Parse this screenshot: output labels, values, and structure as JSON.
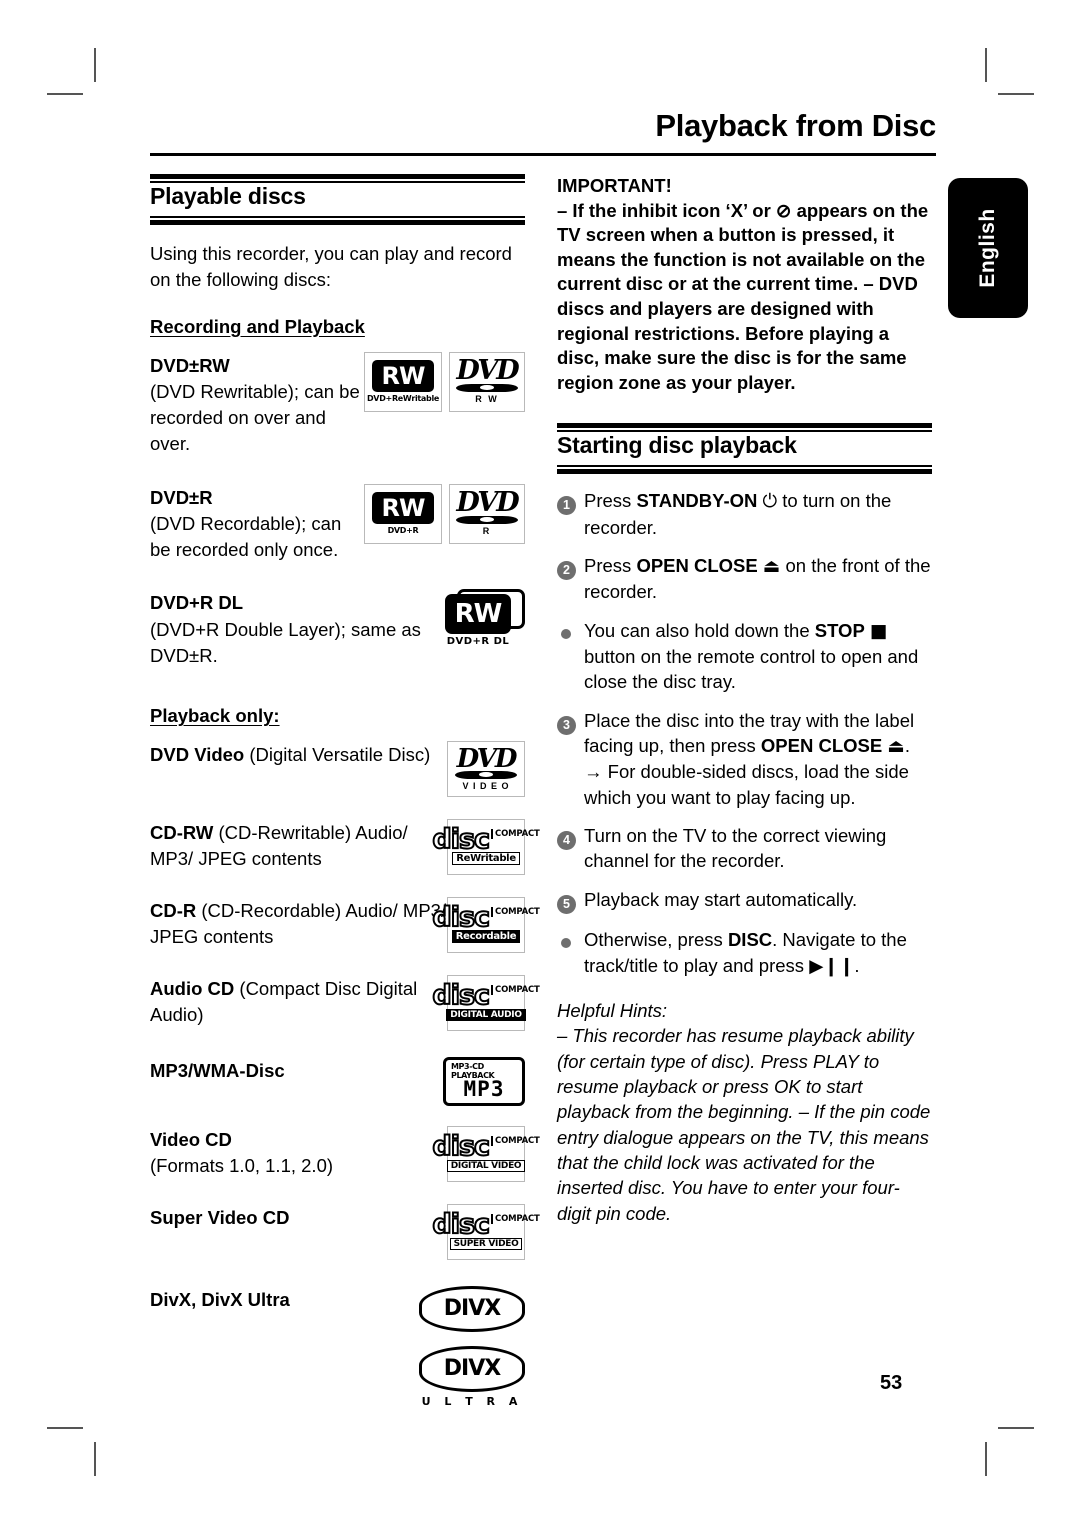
{
  "running_head": "Playback from Disc",
  "language_tab": "English",
  "page_number": "53",
  "left_column": {
    "section_title": "Playable discs",
    "intro": "Using this recorder, you can play and record on the following discs:",
    "subhead_recording": "Recording and Playback",
    "subhead_playback": "Playback only:",
    "recording_items": [
      {
        "title": "DVD±RW",
        "desc": "(DVD Rewritable); can be recorded on over and over.",
        "logos": [
          {
            "type": "rw-box",
            "mark": "RW",
            "caption": "DVD+ReWritable"
          },
          {
            "type": "dvd-box",
            "mark": "DVD",
            "caption": "R W"
          }
        ]
      },
      {
        "title": "DVD±R",
        "desc": "(DVD Recordable); can be recorded only once.",
        "logos": [
          {
            "type": "rw-box",
            "mark": "RW",
            "caption": "DVD+R"
          },
          {
            "type": "dvd-box",
            "mark": "DVD",
            "caption": "R"
          }
        ]
      },
      {
        "title": "DVD+R DL",
        "desc": "(DVD+R Double Layer); same as DVD±R.",
        "logos": [
          {
            "type": "rw-dl",
            "mark": "RW",
            "caption": "DVD+R DL"
          }
        ]
      }
    ],
    "playback_items": [
      {
        "title": "DVD Video",
        "desc": " (Digital Versatile Disc)",
        "logos": [
          {
            "type": "dvd-video",
            "mark": "DVD",
            "caption": "V I D E O"
          }
        ]
      },
      {
        "title": "CD-RW",
        "desc": " (CD-Rewritable) Audio/ MP3/ JPEG contents",
        "logos": [
          {
            "type": "compact-disc",
            "top": "COMPACT",
            "mark": "disc",
            "caption": "ReWritable",
            "invert": false
          }
        ]
      },
      {
        "title": "CD-R",
        "desc": " (CD-Recordable) Audio/ MP3/ JPEG contents",
        "logos": [
          {
            "type": "compact-disc",
            "top": "COMPACT",
            "mark": "disc",
            "caption": "Recordable",
            "invert": true
          }
        ]
      },
      {
        "title": "Audio CD",
        "desc": " (Compact Disc Digital Audio)",
        "logos": [
          {
            "type": "compact-disc",
            "top": "COMPACT",
            "mark": "disc",
            "caption": "DIGITAL AUDIO",
            "invert": true
          }
        ]
      },
      {
        "title": "MP3/WMA-Disc",
        "desc": "",
        "logos": [
          {
            "type": "mp3",
            "top": "MP3-CD PLAYBACK",
            "mark": "MP3"
          }
        ]
      },
      {
        "title": "Video CD",
        "desc": "(Formats 1.0, 1.1, 2.0)",
        "logos": [
          {
            "type": "compact-disc",
            "top": "COMPACT",
            "mark": "disc",
            "caption": "DIGITAL VIDEO",
            "invert": false
          }
        ]
      },
      {
        "title": "Super Video CD",
        "desc": "",
        "logos": [
          {
            "type": "compact-disc",
            "top": "COMPACT",
            "mark": "disc",
            "caption": "SUPER VIDEO",
            "invert": false
          }
        ]
      },
      {
        "title": "DivX, DivX Ultra",
        "desc": "",
        "logos": [
          {
            "type": "divx",
            "mark": "DIVX"
          },
          {
            "type": "divx-ultra",
            "mark": "DIVX",
            "caption": "U L T R A"
          }
        ]
      }
    ]
  },
  "right_column": {
    "important_title": "IMPORTANT!",
    "important_para_1": "– If the inhibit icon ‘X’ or ⊘ appears on the TV screen when a button is pressed, it means the function is not available on the current disc or at the current time.",
    "important_para_2": "– DVD discs and players are designed with regional restrictions. Before playing a disc, make sure the disc is for the same region zone as your player.",
    "section_title": "Starting disc playback",
    "steps": [
      {
        "marker": "1",
        "marker_type": "number",
        "text_before": "Press ",
        "bold": "STANDBY-ON",
        "glyph": "⏻",
        "text_after": " to turn on the recorder."
      },
      {
        "marker": "2",
        "marker_type": "number",
        "text_before": "Press ",
        "bold": "OPEN CLOSE",
        "glyph": "⏏",
        "text_after": " on the front of the recorder."
      },
      {
        "marker": "•",
        "marker_type": "bullet",
        "text_before": "You can also hold down the ",
        "bold": "STOP",
        "glyph": "■",
        "text_after": " button on the remote control to open and close the disc tray."
      },
      {
        "marker": "3",
        "marker_type": "number",
        "text_before": "Place the disc into the tray with the label facing up, then press ",
        "bold": "OPEN CLOSE",
        "glyph": "⏏",
        "text_after": ".",
        "sub": "→ For double-sided discs, load the side which you want to play facing up."
      },
      {
        "marker": "4",
        "marker_type": "number",
        "text_before": "Turn on the TV to the correct viewing channel for the recorder.",
        "bold": "",
        "glyph": "",
        "text_after": ""
      },
      {
        "marker": "5",
        "marker_type": "number",
        "text_before": "Playback may start automatically.",
        "bold": "",
        "glyph": "",
        "text_after": ""
      },
      {
        "marker": "•",
        "marker_type": "bullet",
        "text_before": "Otherwise, press ",
        "bold": "DISC",
        "glyph": "",
        "text_after": ". Navigate to the track/title to play and press ▶❙❙."
      }
    ],
    "hints_title": "Helpful Hints:",
    "hints_para_1": "– This recorder has resume playback ability (for certain type of disc). Press PLAY to resume playback or press OK to start playback from the beginning.",
    "hints_para_2": "– If the pin code entry dialogue appears on the TV, this means that the child lock was activated for the inserted disc. You have to enter your four-digit pin code."
  }
}
